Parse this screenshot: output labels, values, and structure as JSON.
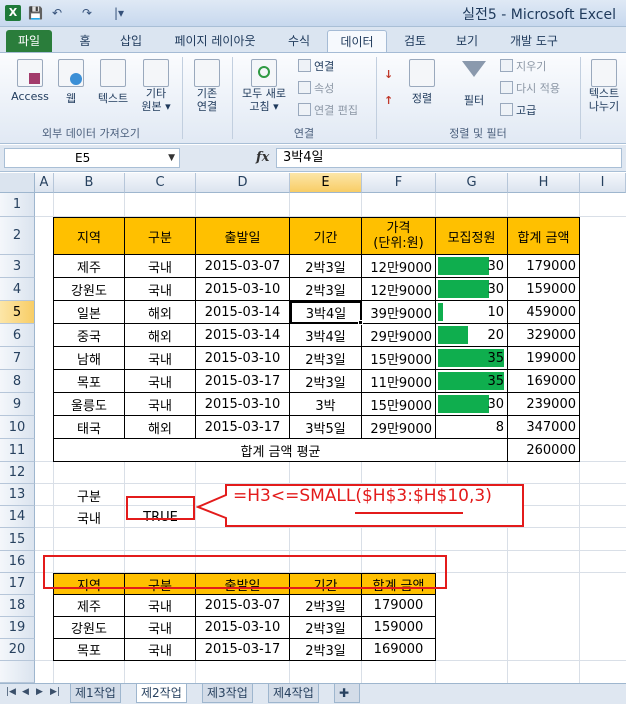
{
  "window": {
    "title": "실전5 - Microsoft Excel"
  },
  "quick_access": {
    "save": "💾",
    "undo": "↶",
    "redo": "↷",
    "more": "|▾"
  },
  "ribbon_tabs": [
    {
      "label": "파일"
    },
    {
      "label": "홈"
    },
    {
      "label": "삽입"
    },
    {
      "label": "페이지 레이아웃"
    },
    {
      "label": "수식"
    },
    {
      "label": "데이터"
    },
    {
      "label": "검토"
    },
    {
      "label": "보기"
    },
    {
      "label": "개발 도구"
    }
  ],
  "ribbon": {
    "access": "Access",
    "web": "웹",
    "text": "텍스트",
    "other1": "기타",
    "other2": "원본 ▾",
    "existing1": "기존",
    "existing2": "연결",
    "refresh1": "모두 새로",
    "refresh2": "고침 ▾",
    "connections": "연결",
    "properties": "속성",
    "edit_links": "연결 편집",
    "sort": "정렬",
    "filter": "필터",
    "clear": "지우기",
    "reapply": "다시 적용",
    "advanced": "고급",
    "text_to_cols1": "텍스트",
    "text_to_cols2": "나누기",
    "group_external": "외부 데이터 가져오기",
    "group_connections": "연결",
    "group_sort_filter": "정렬 및 필터"
  },
  "formula_bar": {
    "name_box": "E5",
    "fx": "fx",
    "formula": "3박4일"
  },
  "columns": [
    "A",
    "B",
    "C",
    "D",
    "E",
    "F",
    "G",
    "H",
    "I"
  ],
  "rows": [
    "1",
    "2",
    "3",
    "4",
    "5",
    "6",
    "7",
    "8",
    "9",
    "10",
    "11",
    "12",
    "13",
    "14",
    "15",
    "16",
    "17",
    "18",
    "19",
    "20"
  ],
  "table": {
    "headers": [
      "지역",
      "구분",
      "출발일",
      "기간",
      "가격",
      "(단위:원)",
      "모집정원",
      "합계 금액"
    ],
    "rows": [
      {
        "region": "제주",
        "type": "국내",
        "date": "2015-03-07",
        "period": "2박3일",
        "price": "12만9000",
        "capacity": "30",
        "total": "179000",
        "fill": 0.78
      },
      {
        "region": "강원도",
        "type": "국내",
        "date": "2015-03-10",
        "period": "2박3일",
        "price": "12만9000",
        "capacity": "30",
        "total": "159000",
        "fill": 0.78
      },
      {
        "region": "일본",
        "type": "해외",
        "date": "2015-03-14",
        "period": "3박4일",
        "price": "39만9000",
        "capacity": "10",
        "total": "459000",
        "fill": 0.08
      },
      {
        "region": "중국",
        "type": "해외",
        "date": "2015-03-14",
        "period": "3박4일",
        "price": "29만9000",
        "capacity": "20",
        "total": "329000",
        "fill": 0.45
      },
      {
        "region": "남해",
        "type": "국내",
        "date": "2015-03-10",
        "period": "2박3일",
        "price": "15만9000",
        "capacity": "35",
        "total": "199000",
        "fill": 1.0
      },
      {
        "region": "목포",
        "type": "국내",
        "date": "2015-03-17",
        "period": "2박3일",
        "price": "11만9000",
        "capacity": "35",
        "total": "169000",
        "fill": 1.0
      },
      {
        "region": "울릉도",
        "type": "국내",
        "date": "2015-03-10",
        "period": "3박",
        "price": "15만9000",
        "capacity": "30",
        "total": "239000",
        "fill": 0.78
      },
      {
        "region": "태국",
        "type": "해외",
        "date": "2015-03-17",
        "period": "3박5일",
        "price": "29만9000",
        "capacity": "8",
        "total": "347000",
        "fill": 0.0
      }
    ],
    "avg_label": "합계 금액 평균",
    "avg_value": "260000"
  },
  "criteria": {
    "header": "구분",
    "value_label": "국내",
    "value": "TRUE"
  },
  "callout": {
    "formula": "=H3<=SMALL($H$3:$H$10,3)"
  },
  "result": {
    "headers": [
      "지역",
      "구분",
      "출발일",
      "기간",
      "합계 금액"
    ],
    "rows": [
      {
        "region": "제주",
        "type": "국내",
        "date": "2015-03-07",
        "period": "2박3일",
        "total": "179000"
      },
      {
        "region": "강원도",
        "type": "국내",
        "date": "2015-03-10",
        "period": "2박3일",
        "total": "159000"
      },
      {
        "region": "목포",
        "type": "국내",
        "date": "2015-03-17",
        "period": "2박3일",
        "total": "169000"
      }
    ]
  },
  "sheets": [
    "제1작업",
    "제2작업",
    "제3작업",
    "제4작업"
  ],
  "colors": {
    "header_fill": "#ffc000",
    "databar": "#0fae4e",
    "annotation": "#e31b1b",
    "file_tab": "#2a7d3b"
  }
}
